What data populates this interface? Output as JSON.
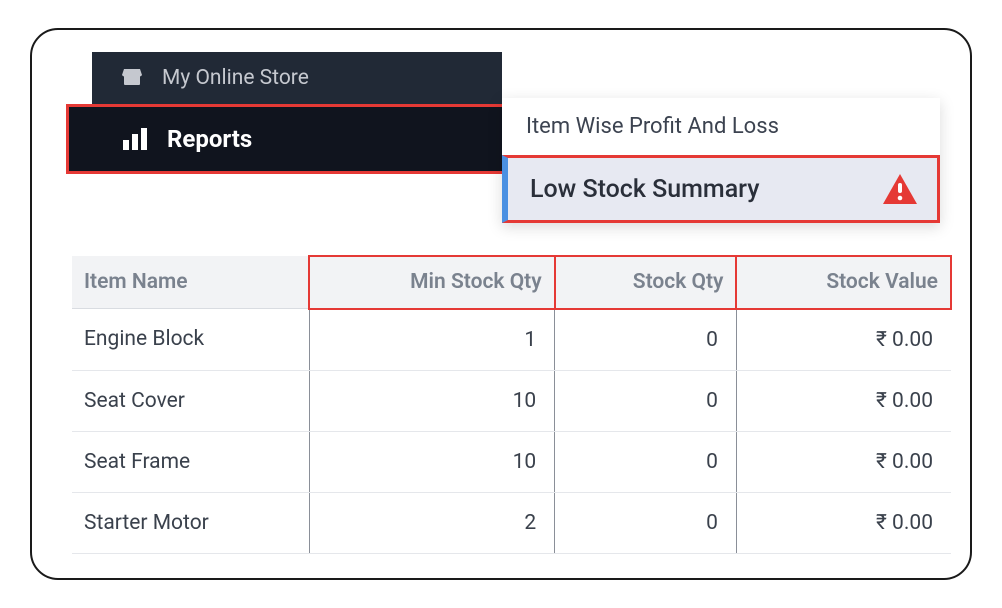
{
  "sidebar": {
    "store_label": "My Online Store",
    "reports_label": "Reports"
  },
  "submenu": {
    "item_profit_loss": "Item Wise Profit And Loss",
    "low_stock_summary": "Low Stock Summary"
  },
  "table": {
    "headers": {
      "item_name": "Item Name",
      "min_stock_qty": "Min Stock Qty",
      "stock_qty": "Stock Qty",
      "stock_value": "Stock Value"
    },
    "rows": [
      {
        "name": "Engine Block",
        "min": "1",
        "qty": "0",
        "value": "₹ 0.00"
      },
      {
        "name": "Seat Cover",
        "min": "10",
        "qty": "0",
        "value": "₹ 0.00"
      },
      {
        "name": "Seat Frame",
        "min": "10",
        "qty": "0",
        "value": "₹ 0.00"
      },
      {
        "name": "Starter Motor",
        "min": "2",
        "qty": "0",
        "value": "₹ 0.00"
      }
    ]
  }
}
